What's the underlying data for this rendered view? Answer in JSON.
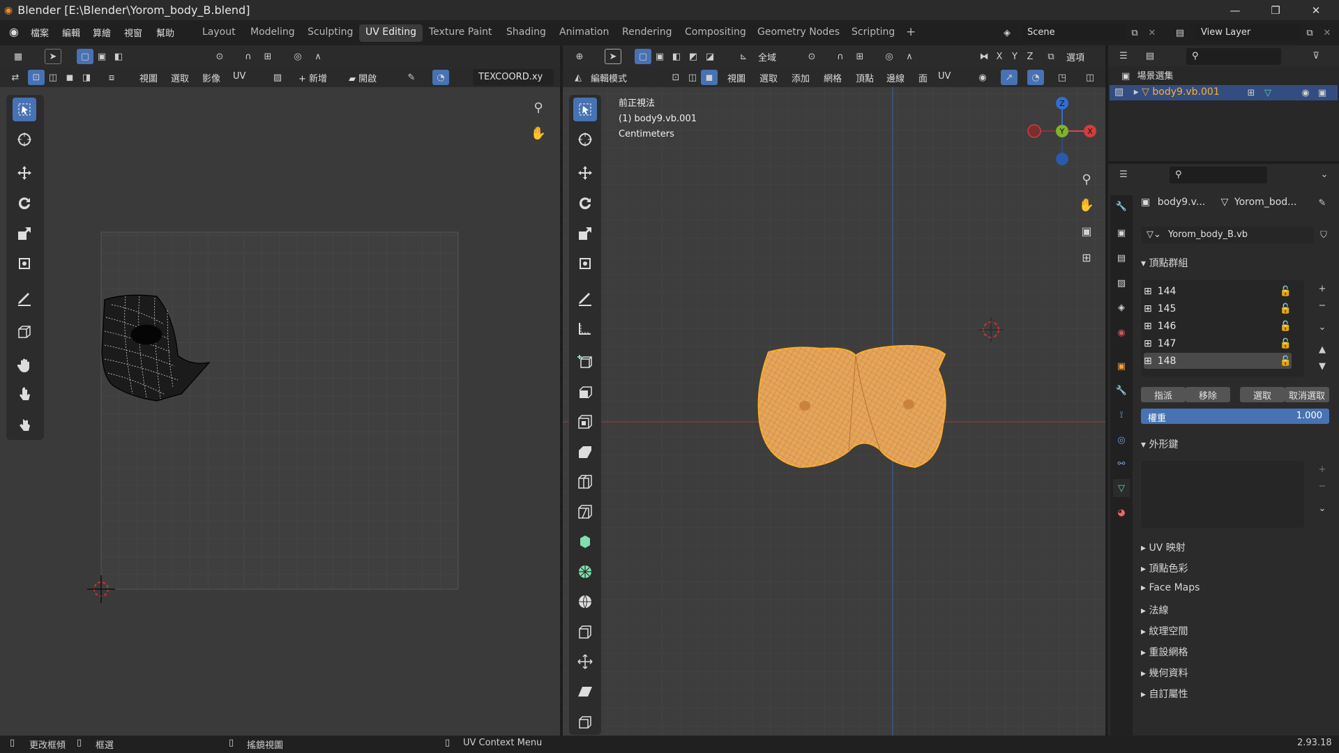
{
  "window": {
    "title": "Blender [E:\\Blender\\Yorom_body_B.blend]",
    "minimize": "—",
    "maximize": "❐",
    "close": "✕"
  },
  "menu": {
    "items": [
      "檔案",
      "編輯",
      "算繪",
      "視窗",
      "幫助"
    ]
  },
  "workspaces": [
    "Layout",
    "Modeling",
    "Sculpting",
    "UV Editing",
    "Texture Paint",
    "Shading",
    "Animation",
    "Rendering",
    "Compositing",
    "Geometry Nodes",
    "Scripting",
    "+"
  ],
  "scene": {
    "name": "Scene",
    "view_layer": "View Layer"
  },
  "uv_editor": {
    "menus": [
      "視圖",
      "選取",
      "影像",
      "UV"
    ],
    "new_label": "新增",
    "open_label": "開啟",
    "uvmap": "TEXCOORD.xy"
  },
  "viewport": {
    "header_menus": [
      "視圖",
      "選取",
      "添加",
      "網格",
      "頂點",
      "邊線",
      "面",
      "UV"
    ],
    "mode": "編輯模式",
    "transform": "全域",
    "options": "選項",
    "axis_labels": {
      "x": "X",
      "y": "Y",
      "z": "Z"
    },
    "overlay_info": [
      "前正視法",
      "(1) body9.vb.001",
      "Centimeters"
    ]
  },
  "outliner": {
    "collection": "場景選集",
    "object": "body9.vb.001"
  },
  "properties": {
    "breadcrumb_obj": "body9.v...",
    "breadcrumb_mesh": "Yorom_bod...",
    "mesh_name": "Yorom_body_B.vb",
    "vertex_groups_title": "頂點群組",
    "vertex_groups": [
      "144",
      "145",
      "146",
      "147",
      "148"
    ],
    "assign": "指派",
    "remove": "移除",
    "select": "選取",
    "deselect": "取消選取",
    "weight_label": "權重",
    "weight_value": "1.000",
    "shape_keys_title": "外形鍵",
    "sections": [
      "UV 映射",
      "頂點色彩",
      "Face Maps",
      "法線",
      "紋理空間",
      "重設網格",
      "幾何資料",
      "自訂屬性"
    ]
  },
  "status": {
    "left1": "更改框傾",
    "left2": "框選",
    "mid": "搖鏡視圖",
    "ctx": "UV Context Menu",
    "version": "2.93.18"
  },
  "colors": {
    "accent": "#4772b3",
    "mesh": "#e5a55a",
    "selected": "#ffaf29"
  }
}
